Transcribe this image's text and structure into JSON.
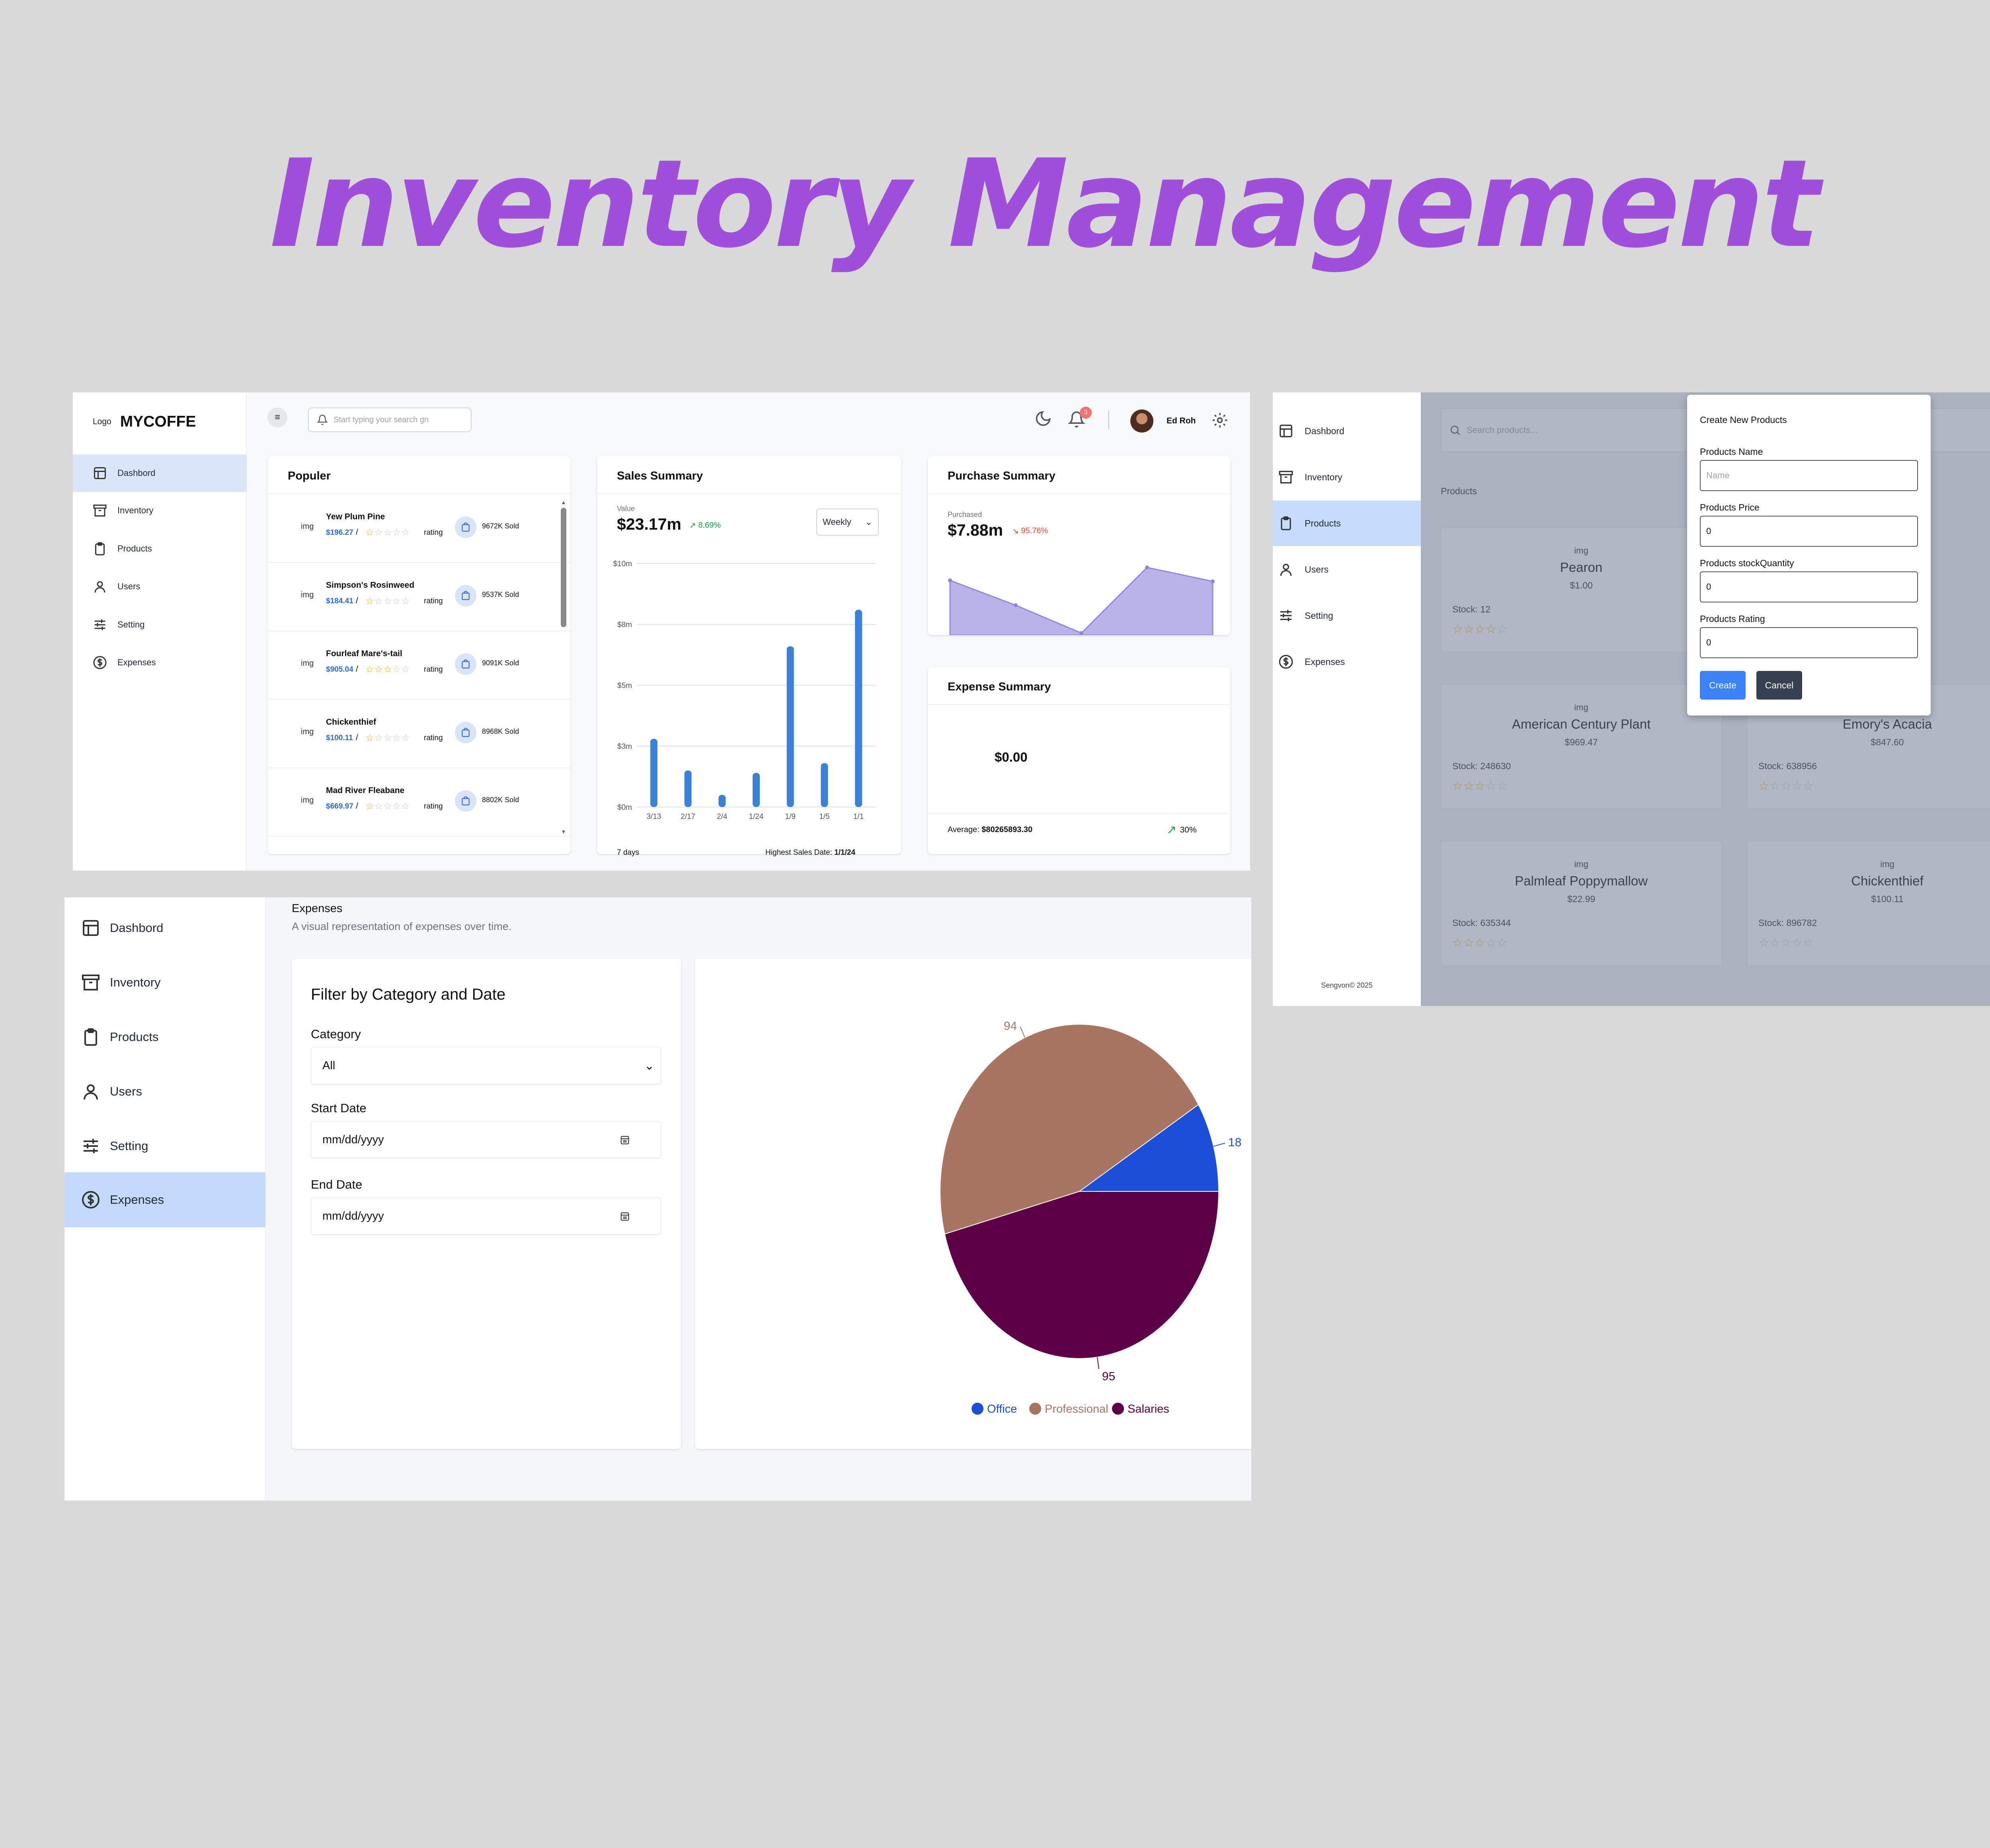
{
  "headline": "Inventory Management",
  "nav": {
    "dashboard": "Dashbord",
    "inventory": "Inventory",
    "products": "Products",
    "users": "Users",
    "setting": "Setting",
    "expenses": "Expenses"
  },
  "dashboard": {
    "logo_small": "Logo",
    "logo_name": "MYCOFFE",
    "search_placeholder": "Start typing your search gn",
    "notification_count": "3",
    "user_name": "Ed Roh",
    "popular": {
      "title": "Populer",
      "rating_label": "rating",
      "img_label": "img",
      "items": [
        {
          "name": "Yew Plum Pine",
          "price": "$196.27",
          "stars": 1,
          "sold": "9672K Sold"
        },
        {
          "name": "Simpson's Rosinweed",
          "price": "$184.41",
          "stars": 1,
          "sold": "9537K Sold"
        },
        {
          "name": "Fourleaf Mare's-tail",
          "price": "$905.04",
          "stars": 3,
          "sold": "9091K Sold"
        },
        {
          "name": "Chickenthief",
          "price": "$100.11",
          "stars": 1,
          "sold": "8968K Sold"
        },
        {
          "name": "Mad River Fleabane",
          "price": "$669.97",
          "stars": 1,
          "sold": "8802K Sold"
        }
      ]
    },
    "sales": {
      "title": "Sales Summary",
      "value_label": "Value",
      "value": "$23.17m",
      "change": "8.69%",
      "period": "Weekly",
      "footer_left": "7 days",
      "footer_right_label": "Highest Sales Date:",
      "footer_right_value": "1/1/24"
    },
    "purchase": {
      "title": "Purchase Summary",
      "label": "Purchased",
      "value": "$7.88m",
      "change": "95.76%",
      "color": "#8c86dc"
    },
    "expense": {
      "title": "Expense Summary",
      "value": "$0.00",
      "average_label": "Average:",
      "average_value": "$80265893.30",
      "change": "30%"
    }
  },
  "products_page": {
    "search_placeholder": "Search products...",
    "section_title": "Products",
    "footer": "Sengvon© 2025",
    "img_label": "img",
    "stock_prefix": "Stock: ",
    "cards": [
      {
        "name": "Pearon",
        "price": "$1.00",
        "stock": "12",
        "stars": 4
      },
      {
        "name": "American Century Plant",
        "price": "$969.47",
        "stock": "248630",
        "stars": 3
      },
      {
        "name": "Emory's Acacia",
        "price": "$847.60",
        "stock": "638956",
        "stars": 1
      },
      {
        "name": "Palmleaf Poppymallow",
        "price": "$22.99",
        "stock": "635344",
        "stars": 3
      },
      {
        "name": "Chickenthief",
        "price": "$100.11",
        "stock": "896782",
        "stars": 0
      }
    ],
    "modal": {
      "title": "Create New Products",
      "name_label": "Products Name",
      "name_placeholder": "Name",
      "price_label": "Products Price",
      "price_value": "0",
      "stock_label": "Products stockQuantity",
      "stock_value": "0",
      "rating_label": "Products Rating",
      "rating_value": "0",
      "create_button": "Create",
      "cancel_button": "Cancel"
    }
  },
  "expenses_page": {
    "title": "Expenses",
    "subtitle": "A visual representation of expenses over time.",
    "filter_title": "Filter by Category and Date",
    "category_label": "Category",
    "category_value": "All",
    "start_label": "Start Date",
    "start_placeholder": "mm/dd/yyyy",
    "end_label": "End Date",
    "end_placeholder": "mm/dd/yyyy"
  },
  "chart_data": [
    {
      "type": "bar",
      "chart": "sales-summary",
      "categories": [
        "3/13",
        "2/17",
        "2/4",
        "1/24",
        "1/9",
        "1/5",
        "1/1"
      ],
      "values": [
        2.8,
        1.5,
        0.5,
        1.4,
        6.6,
        1.8,
        8.1
      ],
      "y_ticks": [
        "$0m",
        "$3m",
        "$5m",
        "$8m",
        "$10m"
      ],
      "ylim": [
        0,
        10
      ],
      "color": "#3b82d6",
      "grid": true
    },
    {
      "type": "area",
      "chart": "purchase-summary",
      "values": [
        5.5,
        3.0,
        0.2,
        6.8,
        5.4
      ],
      "ylim": [
        0,
        8
      ],
      "color": "#8c86dc"
    },
    {
      "type": "pie",
      "chart": "expenses-by-category",
      "categories": [
        "Office",
        "Professional",
        "Salaries"
      ],
      "values": [
        18,
        94,
        95
      ],
      "colors": [
        "#1d4ed8",
        "#a97563",
        "#5e0047"
      ],
      "legend": "bottom"
    }
  ]
}
